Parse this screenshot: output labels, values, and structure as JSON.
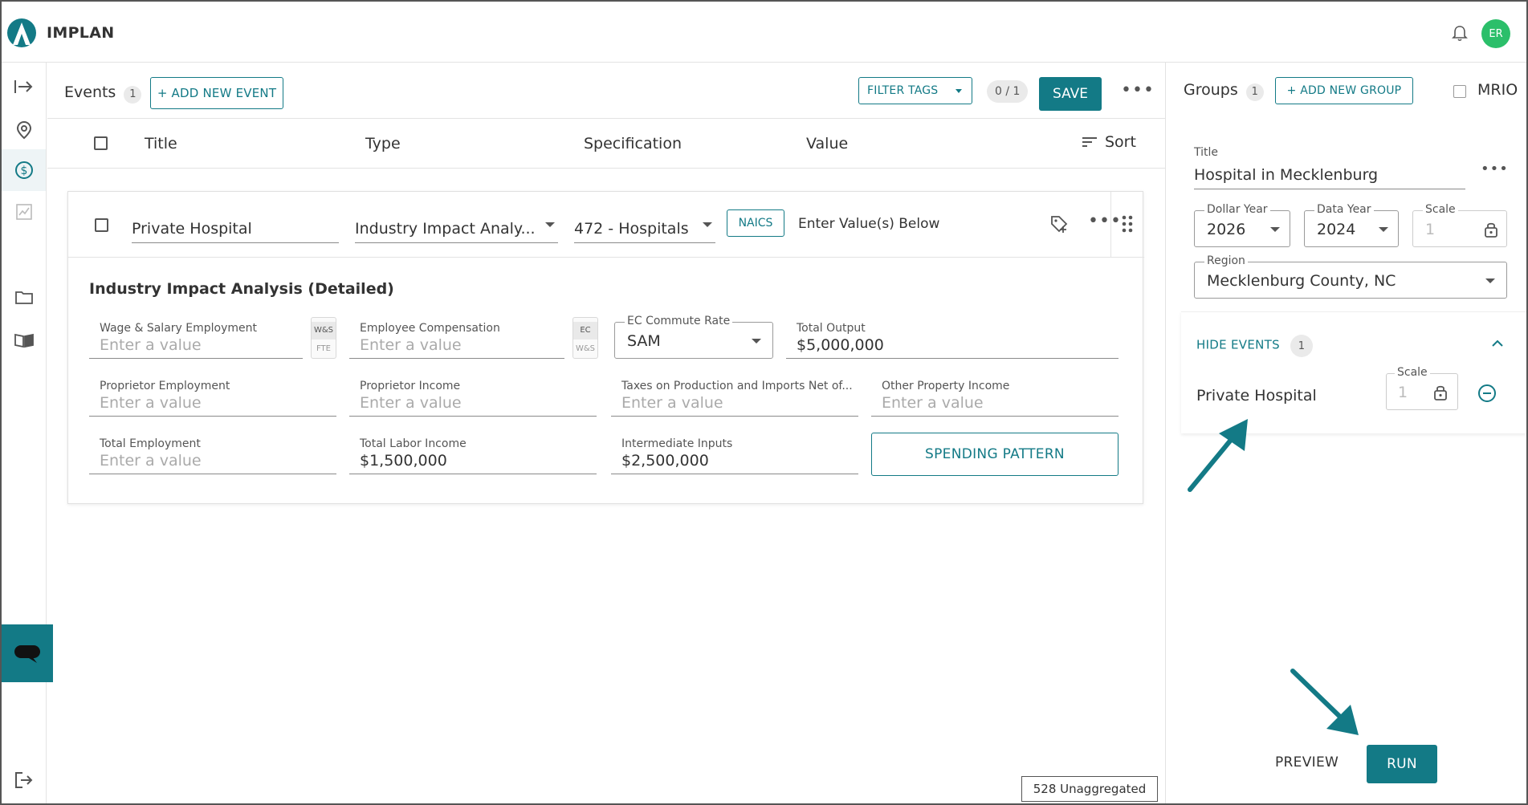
{
  "app": {
    "brand": "IMPLAN",
    "user_initials": "ER",
    "brand_color": "#137a86",
    "avatar_color": "#2bbf6a"
  },
  "rail": {
    "icons": [
      "login-arrow-icon",
      "map-pin-icon",
      "dollar-icon",
      "chart-icon",
      "folder-icon",
      "book-icon",
      "chat-icon",
      "logout-icon"
    ]
  },
  "events": {
    "title": "Events",
    "count": "1",
    "add_label": "+ ADD NEW EVENT",
    "filter_label": "FILTER TAGS",
    "counter": "0 / 1",
    "save_label": "SAVE",
    "columns": {
      "title": "Title",
      "type": "Type",
      "specification": "Specification",
      "value": "Value",
      "sort": "Sort"
    },
    "row": {
      "title": "Private Hospital",
      "type": "Industry Impact Analy...",
      "specification": "472 - Hospitals",
      "naics": "NAICS",
      "value_hint": "Enter Value(s) Below"
    },
    "detail": {
      "section_title": "Industry Impact Analysis (Detailed)",
      "placeholder": "Enter a value",
      "wage_label": "Wage & Salary Employment",
      "wage_tags": [
        "W&S",
        "FTE"
      ],
      "comp_label": "Employee Compensation",
      "comp_tags": [
        "EC",
        "W&S"
      ],
      "commute_label": "EC Commute Rate",
      "commute_value": "SAM",
      "output_label": "Total Output",
      "output_value": "$5,000,000",
      "prop_emp_label": "Proprietor Employment",
      "prop_inc_label": "Proprietor Income",
      "taxes_label": "Taxes on Production and Imports Net of...",
      "other_prop_label": "Other Property Income",
      "total_emp_label": "Total Employment",
      "labor_label": "Total Labor Income",
      "labor_value": "$1,500,000",
      "inputs_label": "Intermediate Inputs",
      "inputs_value": "$2,500,000",
      "spending_label": "SPENDING PATTERN"
    },
    "unaggregated": "528 Unaggregated"
  },
  "groups": {
    "title": "Groups",
    "count": "1",
    "add_label": "+ ADD NEW GROUP",
    "mrio_label": "MRIO",
    "card": {
      "title_label": "Title",
      "title_value": "Hospital in Mecklenburg",
      "dollar_year_label": "Dollar Year",
      "dollar_year": "2026",
      "data_year_label": "Data Year",
      "data_year": "2024",
      "scale_label": "Scale",
      "scale_value": "1",
      "region_label": "Region",
      "region_value": "Mecklenburg County, NC",
      "hide_events_label": "HIDE EVENTS",
      "hide_events_count": "1",
      "event_name": "Private Hospital",
      "event_scale_label": "Scale",
      "event_scale_value": "1"
    },
    "preview_label": "PREVIEW",
    "run_label": "RUN"
  }
}
